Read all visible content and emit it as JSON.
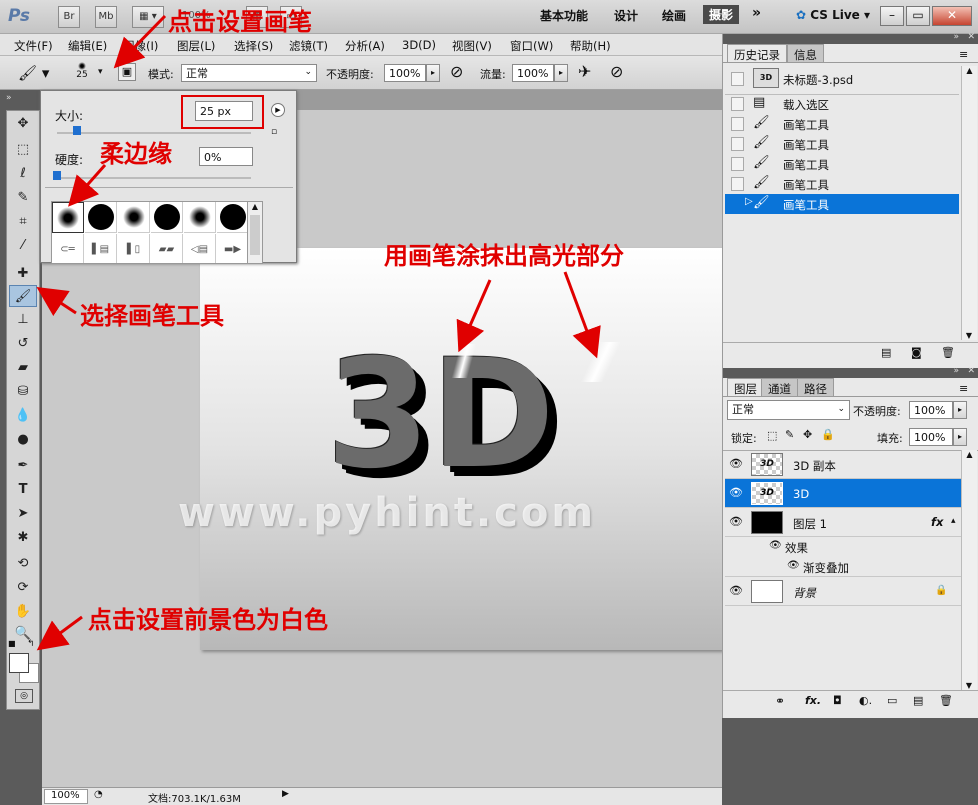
{
  "app": {
    "logo": "Ps",
    "bridge_btn": "Br",
    "minibridge_btn": "Mb",
    "zoom_fragment": "100%",
    "workspaces": [
      "基本功能",
      "设计",
      "绘画",
      "摄影"
    ],
    "more": "»",
    "cslive": "CS Live"
  },
  "menu": [
    "文件(F)",
    "编辑(E)",
    "图像(I)",
    "图层(L)",
    "选择(S)",
    "滤镜(T)",
    "分析(A)",
    "3D(D)",
    "视图(V)",
    "窗口(W)",
    "帮助(H)"
  ],
  "options": {
    "brush_size": "25",
    "mode_label": "模式:",
    "mode_value": "正常",
    "opacity_label": "不透明度:",
    "opacity_value": "100%",
    "flow_label": "流量:",
    "flow_value": "100%"
  },
  "brush_panel": {
    "size_label": "大小:",
    "size_value": "25 px",
    "hardness_label": "硬度:",
    "hardness_value": "0%",
    "size_level": 0.08,
    "hardness_level": 0.0
  },
  "history": {
    "tabs": [
      "历史记录",
      "信息"
    ],
    "snapshot": "未标题-3.psd",
    "snapshot_thumb": "3D",
    "items": [
      "载入选区",
      "画笔工具",
      "画笔工具",
      "画笔工具",
      "画笔工具",
      "画笔工具"
    ],
    "selected_index": 5
  },
  "layers": {
    "tabs": [
      "图层",
      "通道",
      "路径"
    ],
    "blend_mode": "正常",
    "opacity_label": "不透明度:",
    "opacity_value": "100%",
    "lock_label": "锁定:",
    "fill_label": "填充:",
    "fill_value": "100%",
    "rows": [
      {
        "name": "3D 副本",
        "thumb": "3D"
      },
      {
        "name": "3D",
        "thumb": "3D"
      },
      {
        "name": "图层 1",
        "thumb": ""
      },
      {
        "name": "效果",
        "thumb": ""
      },
      {
        "name": "渐变叠加",
        "thumb": ""
      },
      {
        "name": "背景",
        "thumb": ""
      }
    ],
    "fx_label": "fx"
  },
  "status": {
    "zoom": "100%",
    "doc": "文档:703.1K/1.63M"
  },
  "canvas": {
    "text": "3D",
    "watermark": "www.pyhint.com"
  },
  "annotations": {
    "brush_setting": "点击设置画笔",
    "soft_edge": "柔边缘",
    "highlight": "用画笔涂抹出高光部分",
    "select_brush": "选择画笔工具",
    "foreground": "点击设置前景色为白色"
  },
  "colors": {
    "accent": "#0078d7",
    "annotation": "#e00000"
  }
}
